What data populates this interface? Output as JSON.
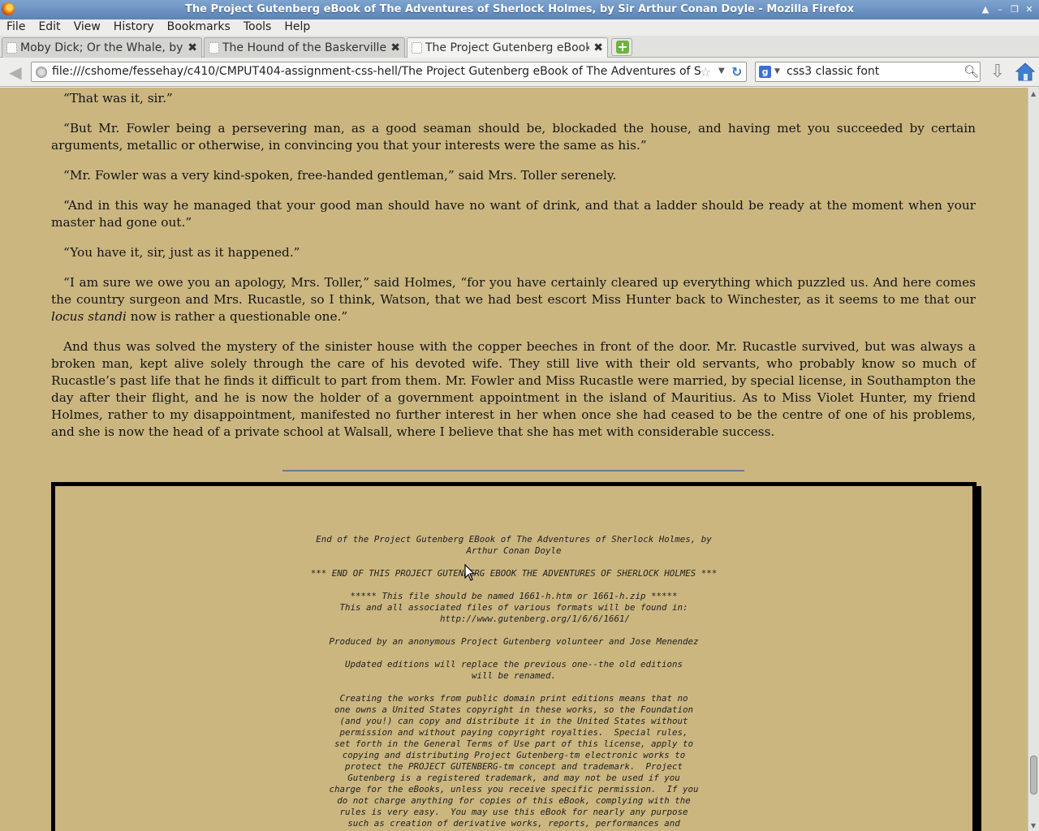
{
  "window": {
    "title": "The Project Gutenberg eBook of The Adventures of Sherlock Holmes, by Sir Arthur Conan Doyle - Mozilla Firefox"
  },
  "menu": [
    {
      "label": "File"
    },
    {
      "label": "Edit"
    },
    {
      "label": "View"
    },
    {
      "label": "History"
    },
    {
      "label": "Bookmarks"
    },
    {
      "label": "Tools"
    },
    {
      "label": "Help"
    }
  ],
  "tabs": [
    {
      "label": "Moby Dick; Or the Whale, by ...",
      "active": false
    },
    {
      "label": "The Hound of the Baskerville...",
      "active": false
    },
    {
      "label": "The Project Gutenberg eBook...",
      "active": true
    }
  ],
  "tab_close_glyph": "✖",
  "newtab_glyph": "+",
  "navbar": {
    "url": "file:///cshome/fessehay/c410/CMPUT404-assignment-css-hell/The Project Gutenberg eBook of The Adventures of Sherlock",
    "search_query": "css3 classic font",
    "search_engine_glyph": "g"
  },
  "content": {
    "paragraphs": [
      "“That was it, sir.”",
      "“But Mr. Fowler being a persevering man, as a good seaman should be, blockaded the house, and having met you succeeded by certain arguments, metallic or otherwise, in convincing you that your interests were the same as his.”",
      "“Mr. Fowler was a very kind-spoken, free-handed gentleman,” said Mrs. Toller serenely.",
      "“And in this way he managed that your good man should have no want of drink, and that a ladder should be ready at the moment when your master had gone out.”",
      "“You have it, sir, just as it happened.”",
      "And thus was solved the mystery of the sinister house with the copper beeches in front of the door. Mr. Rucastle survived, but was always a broken man, kept alive solely through the care of his devoted wife. They still live with their old servants, who probably know so much of Rucastle’s past life that he finds it difficult to part from them. Mr. Fowler and Miss Rucastle were married, by special license, in Southampton the day after their flight, and he is now the holder of a government appointment in the island of Mauritius. As to Miss Violet Hunter, my friend Holmes, rather to my disappointment, manifested no further interest in her when once she had ceased to be the centre of one of his problems, and she is now the head of a private school at Walsall, where I believe that she has met with considerable success."
    ],
    "apology_paragraph": {
      "before": "“I am sure we owe you an apology, Mrs. Toller,” said Holmes, “for you have certainly cleared up everything which puzzled us. And here comes the country surgeon and Mrs. Rucastle, so I think, Watson, that we had best escort Miss Hunter back to Winchester, as it seems to me that our ",
      "italic": "locus standi",
      "after": " now is rather a questionable one.”"
    },
    "license_text": "End of the Project Gutenberg EBook of The Adventures of Sherlock Holmes, by\nArthur Conan Doyle\n\n*** END OF THIS PROJECT GUTENBERG EBOOK THE ADVENTURES OF SHERLOCK HOLMES ***\n\n***** This file should be named 1661-h.htm or 1661-h.zip *****\nThis and all associated files of various formats will be found in:\n        http://www.gutenberg.org/1/6/6/1661/\n\nProduced by an anonymous Project Gutenberg volunteer and Jose Menendez\n\nUpdated editions will replace the previous one--the old editions\nwill be renamed.\n\nCreating the works from public domain print editions means that no\none owns a United States copyright in these works, so the Foundation\n(and you!) can copy and distribute it in the United States without\npermission and without paying copyright royalties.  Special rules,\nset forth in the General Terms of Use part of this license, apply to\ncopying and distributing Project Gutenberg-tm electronic works to\nprotect the PROJECT GUTENBERG-tm concept and trademark.  Project\nGutenberg is a registered trademark, and may not be used if you\ncharge for the eBooks, unless you receive specific permission.  If you\ndo not charge anything for copies of this eBook, complying with the\nrules is very easy.  You may use this eBook for nearly any purpose\nsuch as creation of derivative works, reports, performances and\nresearch.  They may be modified and printed and given away--you may do"
  },
  "colors": {
    "page_background": "#cbb680",
    "titlebar": "#6b90c2",
    "chrome": "#ededeb"
  }
}
